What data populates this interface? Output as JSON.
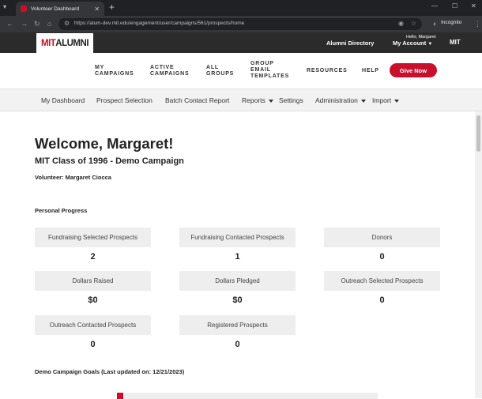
{
  "browser": {
    "tab_title": "Volunteer Dashboard",
    "url": "https://alum-dev.mit.edu/engagement/user/campaigns/561/prospects/home",
    "incognito_label": "Incognito"
  },
  "topbar": {
    "logo_mit": "MIT",
    "logo_alumni": "ALUMNI",
    "alumni_directory": "Alumni Directory",
    "hello": "Hello, Margaret",
    "my_account": "My Account"
  },
  "mainnav": {
    "my_campaigns_1": "MY",
    "my_campaigns_2": "CAMPAIGNS",
    "active_1": "ACTIVE",
    "active_2": "CAMPAIGNS",
    "all_1": "ALL",
    "all_2": "GROUPS",
    "group_1": "GROUP",
    "group_2": "EMAIL",
    "group_3": "TEMPLATES",
    "resources": "RESOURCES",
    "help": "HELP",
    "give_now": "Give Now"
  },
  "subnav": {
    "dashboard": "My Dashboard",
    "prospect_selection": "Prospect Selection",
    "batch_contact": "Batch Contact Report",
    "reports": "Reports",
    "settings": "Settings",
    "administration": "Administration",
    "import": "Import"
  },
  "content": {
    "welcome": "Welcome, Margaret!",
    "campaign": "MIT Class of 1996 - Demo Campaign",
    "volunteer": "Volunteer: Margaret Ciocca",
    "personal_progress": "Personal Progress",
    "goals_heading": "Demo Campaign Goals (Last updated on: 12/21/2023)"
  },
  "cards": [
    {
      "label": "Fundraising Selected Prospects",
      "value": "2"
    },
    {
      "label": "Fundraising Contacted Prospects",
      "value": "1"
    },
    {
      "label": "Donors",
      "value": "0"
    },
    {
      "label": "Dollars Raised",
      "value": "$0"
    },
    {
      "label": "Dollars Pledged",
      "value": "$0"
    },
    {
      "label": "Outreach Selected Prospects",
      "value": "0"
    },
    {
      "label": "Outreach Contacted Prospects",
      "value": "0"
    },
    {
      "label": "Registered Prospects",
      "value": "0"
    }
  ],
  "colors": {
    "brand_red": "#c8102e",
    "dark_bar": "#2b2b2b"
  }
}
